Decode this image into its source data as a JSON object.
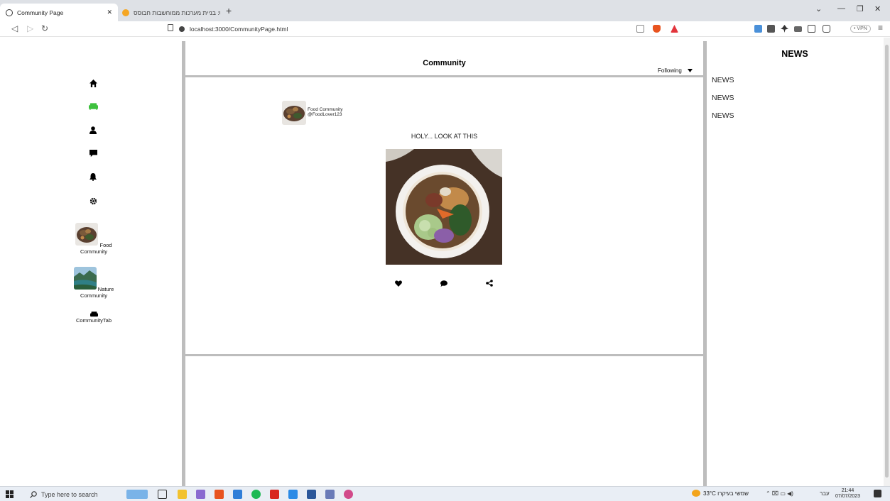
{
  "browser": {
    "active_tab_title": "Community Page",
    "inactive_tab_title": "קורס: בניית מערכות ממוחשבות חבוסס",
    "url": "localhost:3000/CommunityPage.html",
    "vpn_label": "• VPN"
  },
  "sidebar": {
    "nav_icons": [
      "home-icon",
      "couch-icon",
      "user-icon",
      "chat-icon",
      "bell-icon",
      "gear-icon"
    ],
    "active_color": "#3ec13e",
    "communities": [
      {
        "label": "Food Community",
        "icon": "food-thumbnail"
      },
      {
        "label": "Nature Community",
        "icon": "nature-thumbnail"
      },
      {
        "label": "CommunityTab",
        "icon": "couch-icon"
      }
    ]
  },
  "header": {
    "title": "Community",
    "filter_selected": "Following"
  },
  "post": {
    "community_name": "Food Community",
    "handle": "@FoodLover123",
    "text": "HOLY... LOOK AT THIS",
    "actions": [
      "heart-icon",
      "comment-icon",
      "share-icon"
    ]
  },
  "news": {
    "title": "NEWS",
    "items": [
      "NEWS",
      "NEWS",
      "NEWS"
    ]
  },
  "taskbar": {
    "search_placeholder": "Type here to search",
    "weather": "33°C שמשי בעיקרו",
    "day_label": "עבר",
    "time": "21:44",
    "date": "07/07/2023"
  }
}
